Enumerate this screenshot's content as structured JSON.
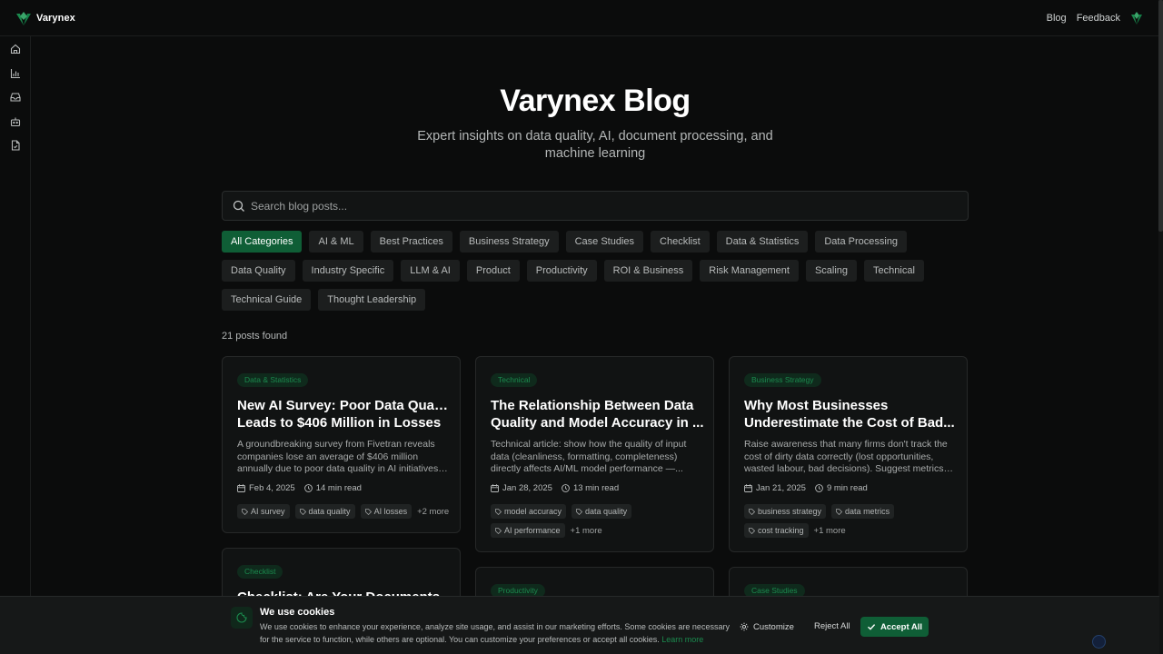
{
  "header": {
    "brand": "Varynex",
    "nav": {
      "blog": "Blog",
      "feedback": "Feedback"
    }
  },
  "sidebar": {
    "items": [
      {
        "icon": "home-icon"
      },
      {
        "icon": "bar-chart-icon"
      },
      {
        "icon": "inbox-icon"
      },
      {
        "icon": "robot-icon"
      },
      {
        "icon": "document-icon"
      }
    ]
  },
  "hero": {
    "title": "Varynex Blog",
    "subtitle": "Expert insights on data quality, AI, document processing, and machine learning"
  },
  "search": {
    "placeholder": "Search blog posts..."
  },
  "categories": [
    "All Categories",
    "AI & ML",
    "Best Practices",
    "Business Strategy",
    "Case Studies",
    "Checklist",
    "Data & Statistics",
    "Data Processing",
    "Data Quality",
    "Industry Specific",
    "LLM & AI",
    "Product",
    "Productivity",
    "ROI & Business",
    "Risk Management",
    "Scaling",
    "Technical",
    "Technical Guide",
    "Thought Leadership"
  ],
  "results": {
    "count": "21 posts found"
  },
  "posts": [
    {
      "category": "Data & Statistics",
      "title_line1": "New AI Survey: Poor Data Quality",
      "title_line2": "Leads to $406 Million in Losses",
      "desc_line1": "A groundbreaking survey from Fivetran reveals",
      "desc_line2": "companies lose an average of $406 million",
      "desc_line3": "annually due to poor data quality in AI initiatives....",
      "date": "Feb 4, 2025",
      "read": "14 min read",
      "tags": [
        "AI survey",
        "data quality",
        "AI losses"
      ],
      "more": "+2 more"
    },
    {
      "category": "Technical",
      "title_line1": "The Relationship Between Data",
      "title_line2": "Quality and Model Accuracy in ...",
      "desc_line1": "Technical article: show how the quality of input",
      "desc_line2": "data (cleanliness, formatting, completeness)",
      "desc_line3": "directly affects AI/ML model performance —...",
      "date": "Jan 28, 2025",
      "read": "13 min read",
      "tags": [
        "model accuracy",
        "data quality",
        "AI performance"
      ],
      "more": "+1 more"
    },
    {
      "category": "Business Strategy",
      "title_line1": "Why Most Businesses",
      "title_line2": "Underestimate the Cost of Bad...",
      "desc_line1": "Raise awareness that many firms don't track the",
      "desc_line2": "cost of dirty data correctly (lost opportunities,",
      "desc_line3": "wasted labour, bad decisions). Suggest metrics to...",
      "date": "Jan 21, 2025",
      "read": "9 min read",
      "tags": [
        "business strategy",
        "data metrics",
        "cost tracking"
      ],
      "more": "+1 more"
    },
    {
      "category": "Checklist",
      "title_line1": "Checklist: Are Your Documents"
    },
    {
      "category": "Productivity"
    },
    {
      "category": "Case Studies"
    }
  ],
  "cookie": {
    "title": "We use cookies",
    "text": "We use cookies to enhance your experience, analyze site usage, and assist in our marketing efforts. Some cookies are necessary for the service to function, while others are optional. You can customize your preferences or accept all cookies.",
    "learn_more": "Learn more",
    "customize": "Customize",
    "reject": "Reject All",
    "accept": "Accept All"
  },
  "colors": {
    "accent": "#0f5e36",
    "accent_text": "#1b8a4e",
    "background": "#0b0c0c",
    "card": "#111313"
  }
}
